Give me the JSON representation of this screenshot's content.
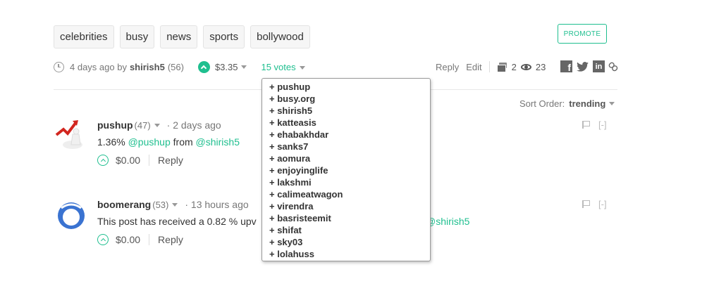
{
  "tags": [
    "celebrities",
    "busy",
    "news",
    "sports",
    "bollywood"
  ],
  "promote_label": "PROMOTE",
  "post": {
    "time_ago": "4 days ago by",
    "author": "shirish5",
    "author_rep": "(56)",
    "payout": "$3.35",
    "votes_label": "15 votes",
    "reply_label": "Reply",
    "edit_label": "Edit",
    "comments_count": "2",
    "views_count": "23"
  },
  "share_icons": [
    "facebook-icon",
    "twitter-icon",
    "linkedin-icon",
    "link-icon"
  ],
  "sort": {
    "label": "Sort Order:",
    "value": "trending"
  },
  "voters": [
    "+ pushup",
    "+ busy.org",
    "+ shirish5",
    "+ katteasis",
    "+ ehabakhdar",
    "+ sanks7",
    "+ aomura",
    "+ enjoyinglife",
    "+ lakshmi",
    "+ calimeatwagon",
    "+ virendra",
    "+ basristeemit",
    "+ shifat",
    "+ sky03",
    "+ lolahuss"
  ],
  "comments": [
    {
      "author": "pushup",
      "rep": "(47)",
      "time": "· 2 days ago",
      "body_prefix": "1.36% ",
      "mention1": "@pushup",
      "body_mid": " from ",
      "mention2": "@shirish5",
      "payout": "$0.00",
      "reply": "Reply",
      "collapse": "[-]"
    },
    {
      "author": "boomerang",
      "rep": "(53)",
      "time": "· 13 hours ago",
      "body_prefix": "This post has received a 0.82 % upv",
      "mention1": "@shirish5",
      "payout": "$0.00",
      "reply": "Reply",
      "collapse": "[-]"
    }
  ],
  "colors": {
    "accent": "#1fbf8f",
    "text": "#333333",
    "muted": "#777777"
  }
}
